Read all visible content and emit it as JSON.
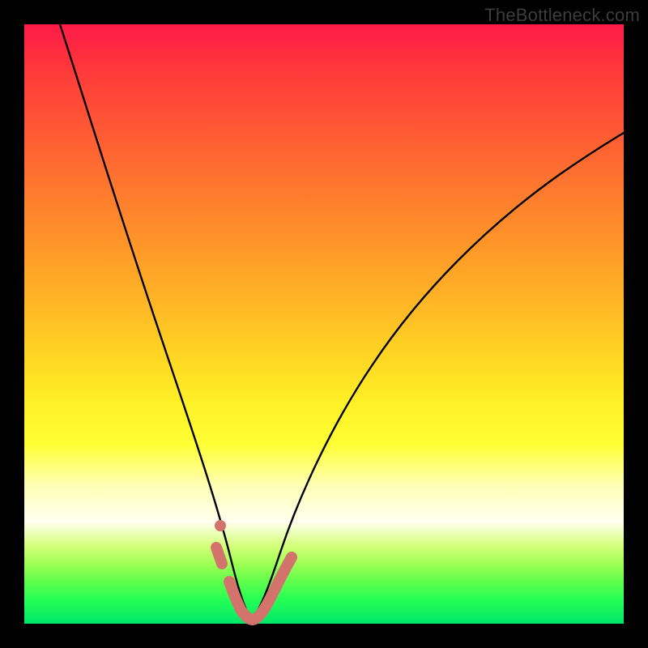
{
  "watermark": "TheBottleneck.com",
  "colors": {
    "background": "#000000",
    "curve": "#000000",
    "curve_highlight": "#d2746c",
    "watermark_text": "#3d3d3d"
  },
  "chart_data": {
    "type": "line",
    "title": "",
    "xlabel": "",
    "ylabel": "",
    "xlim": [
      0,
      100
    ],
    "ylim": [
      0,
      100
    ],
    "grid": false,
    "legend": false,
    "annotations": [
      "TheBottleneck.com"
    ],
    "note": "V-shaped bottleneck curve on a red-to-green vertical gradient. Values estimated from pixel position; no axis ticks or numeric labels are rendered.",
    "series": [
      {
        "name": "bottleneck-curve",
        "type": "line",
        "x": [
          6,
          8,
          10,
          12,
          15,
          18,
          22,
          26,
          29,
          31,
          33,
          34.5,
          36,
          37,
          38,
          39,
          41,
          43,
          46,
          50,
          55,
          60,
          66,
          73,
          80,
          88,
          96,
          100
        ],
        "y": [
          100,
          88,
          77,
          69,
          59,
          51,
          41,
          30,
          21,
          15,
          10,
          6,
          3,
          1.3,
          0.7,
          1.3,
          3,
          6,
          11,
          18,
          27,
          34,
          42,
          50,
          57,
          64,
          70,
          73
        ]
      },
      {
        "name": "highlight-left",
        "type": "line",
        "style": "thick-rounded",
        "color": "#d2746c",
        "x": [
          31.8,
          32.8
        ],
        "y": [
          12.4,
          9.8
        ]
      },
      {
        "name": "highlight-dot",
        "type": "scatter",
        "color": "#d2746c",
        "x": [
          32.7
        ],
        "y": [
          16.3
        ]
      },
      {
        "name": "highlight-valley",
        "type": "line",
        "style": "thick-rounded",
        "color": "#d2746c",
        "x": [
          34.0,
          35.0,
          36.0,
          37.0,
          38.0,
          39.0,
          40.0,
          41.0,
          42.0,
          43.0,
          44.0,
          44.6
        ],
        "y": [
          6.2,
          3.8,
          2.2,
          1.2,
          0.8,
          1.2,
          2.2,
          3.6,
          5.4,
          7.4,
          9.4,
          10.5
        ]
      }
    ]
  }
}
